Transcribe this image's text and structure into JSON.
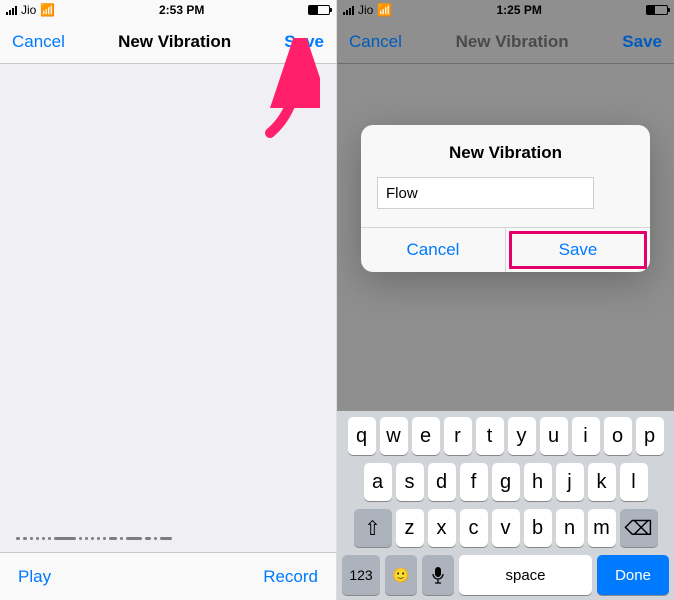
{
  "left": {
    "status": {
      "carrier": "Jio",
      "wifi": true,
      "time": "2:53 PM",
      "battery_pct": 45
    },
    "nav": {
      "cancel": "Cancel",
      "title": "New Vibration",
      "save": "Save"
    },
    "pattern_segments": [
      4,
      4,
      3,
      3,
      3,
      3,
      22,
      3,
      3,
      3,
      3,
      3,
      8,
      3,
      16,
      6,
      3,
      12
    ],
    "footer": {
      "play": "Play",
      "record": "Record"
    }
  },
  "right": {
    "status": {
      "carrier": "Jio",
      "wifi": true,
      "time": "1:25 PM",
      "battery_pct": 40
    },
    "nav": {
      "cancel": "Cancel",
      "title": "New Vibration",
      "save": "Save"
    },
    "modal": {
      "title": "New Vibration",
      "input_value": "Flow",
      "cancel": "Cancel",
      "save": "Save"
    },
    "keyboard": {
      "row1": [
        "q",
        "w",
        "e",
        "r",
        "t",
        "y",
        "u",
        "i",
        "o",
        "p"
      ],
      "row2": [
        "a",
        "s",
        "d",
        "f",
        "g",
        "h",
        "j",
        "k",
        "l"
      ],
      "row3": [
        "z",
        "x",
        "c",
        "v",
        "b",
        "n",
        "m"
      ],
      "shift": "⇧",
      "backspace": "⌫",
      "numbers": "123",
      "emoji": "😀",
      "mic": "🎤",
      "space": "space",
      "done": "Done"
    }
  }
}
